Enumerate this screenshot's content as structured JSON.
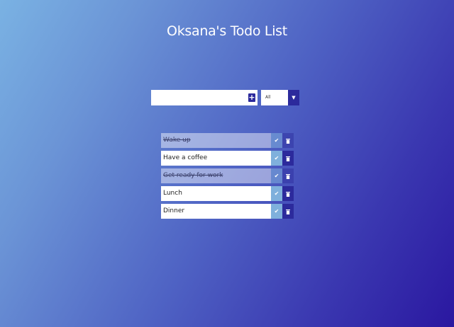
{
  "app": {
    "title": "Oksana's Todo List"
  },
  "add_form": {
    "input_value": "",
    "add_icon": "plus-icon"
  },
  "filter": {
    "selected": "All",
    "arrow_icon": "caret-down-icon"
  },
  "todos": [
    {
      "text": "Wake up",
      "completed": true
    },
    {
      "text": "Have a coffee",
      "completed": false
    },
    {
      "text": "Get ready for work",
      "completed": true
    },
    {
      "text": "Lunch",
      "completed": false
    },
    {
      "text": "Dinner",
      "completed": false
    }
  ],
  "icons": {
    "check": "check-icon",
    "trash": "trash-icon"
  },
  "colors": {
    "accent": "#2c2a9c",
    "check_bg": "#7fb0dc",
    "gradient_start": "#7ab2e3",
    "gradient_end": "#2a17a0"
  }
}
